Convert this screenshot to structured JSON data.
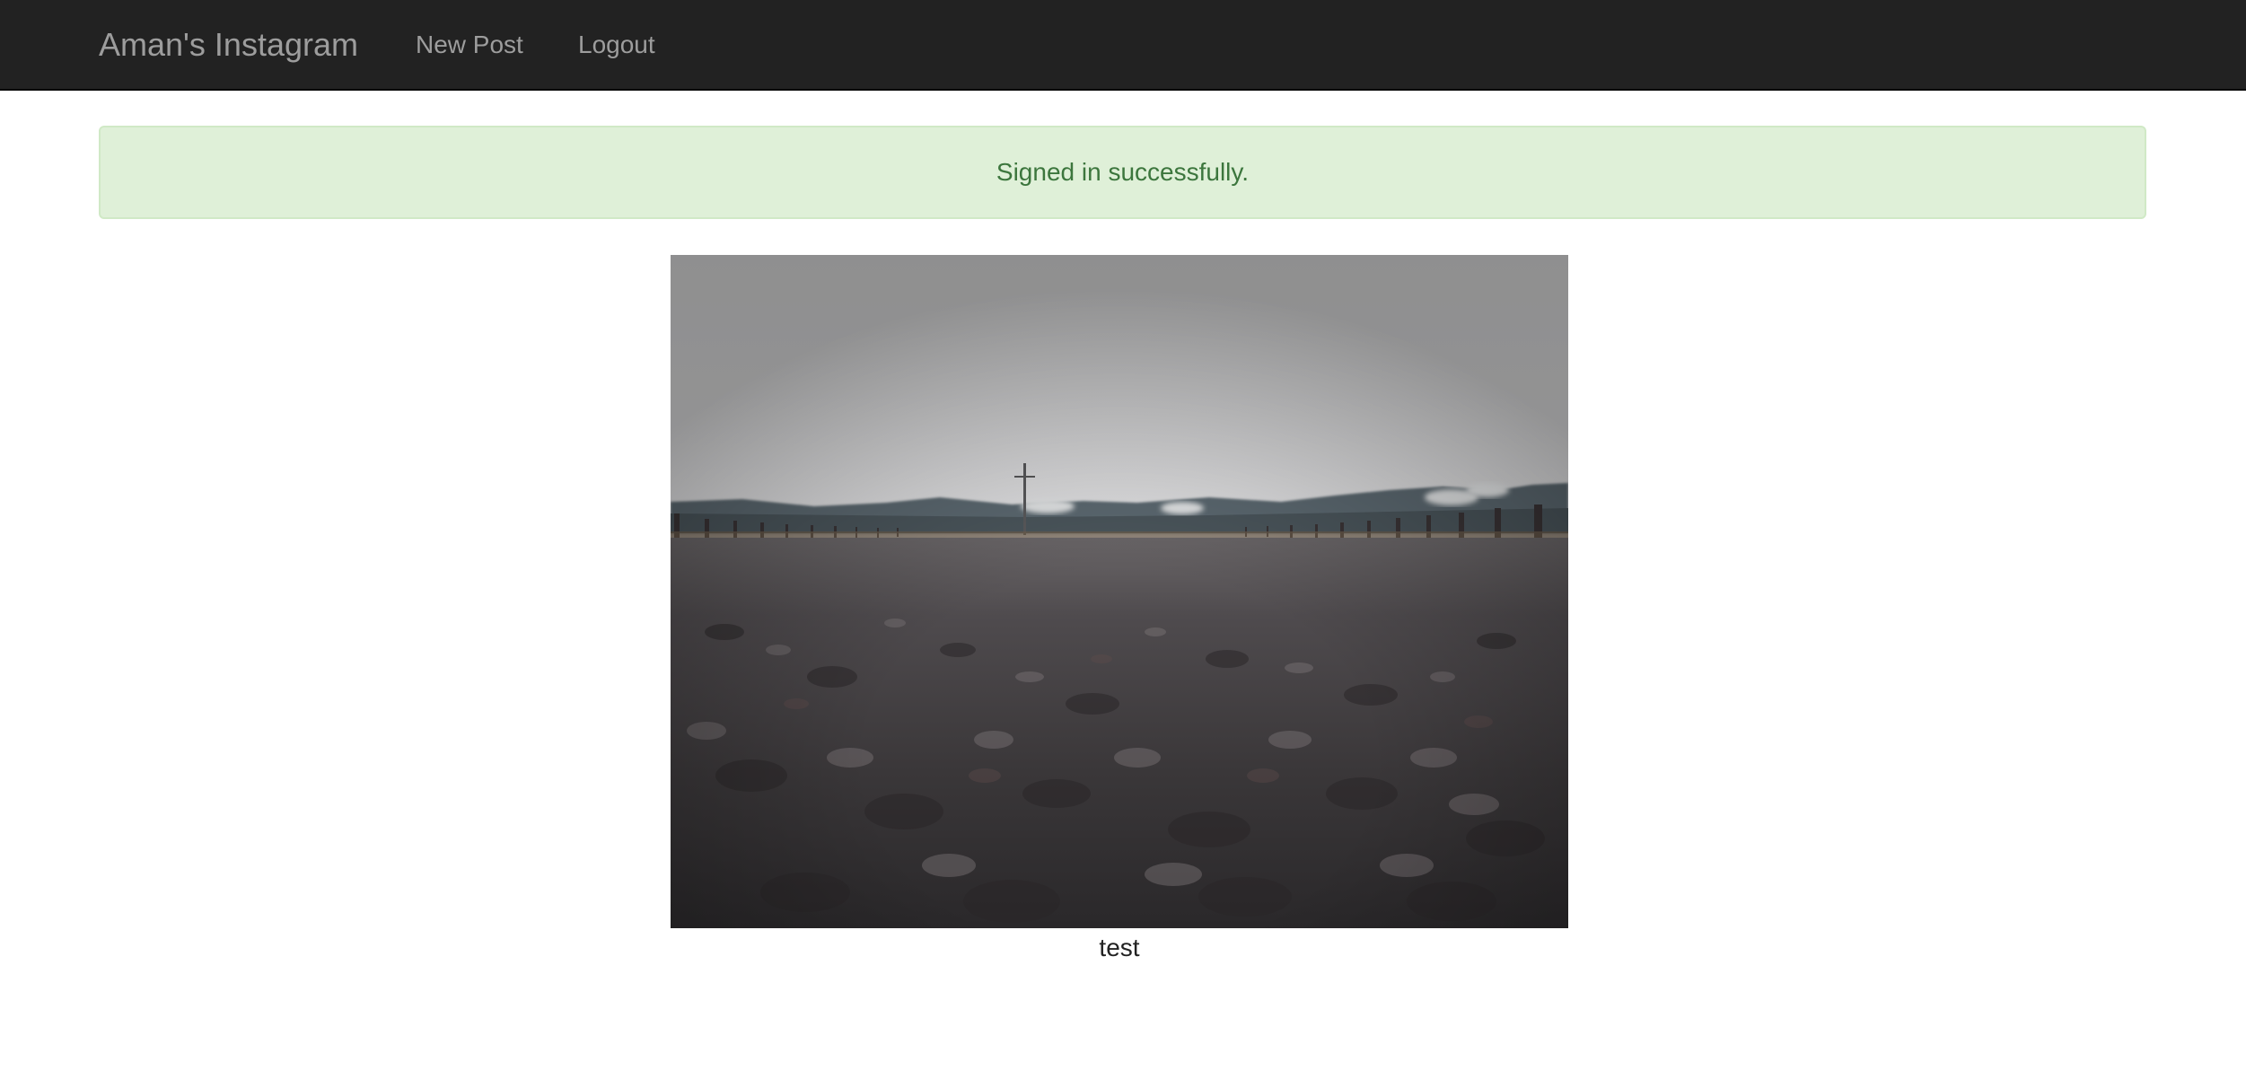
{
  "navbar": {
    "brand": "Aman's Instagram",
    "links": [
      {
        "label": "New Post"
      },
      {
        "label": "Logout"
      }
    ],
    "background": "#222222",
    "link_color": "#9d9d9d"
  },
  "flash": {
    "message": "Signed in successfully.",
    "background": "#dff0d8",
    "text_color": "#3c763d"
  },
  "post": {
    "image_subject": "low-angle photo of gravel road under overcast sky",
    "caption": "test"
  }
}
